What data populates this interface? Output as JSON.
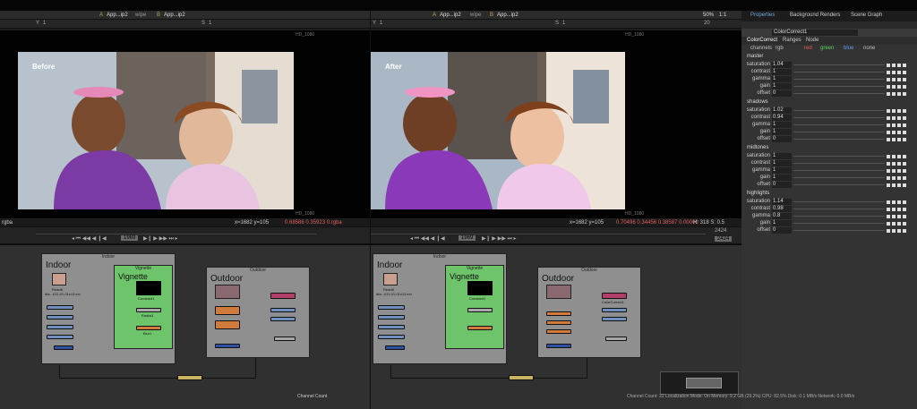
{
  "viewer_left": {
    "tab1": "App...ip2",
    "tab2": "App...ip2",
    "a_label": "A",
    "b_label": "B",
    "wipe": "wipe",
    "ctrl_y": "Y",
    "ctrl_y_val": "1",
    "ctrl_s": "S",
    "ctrl_s_val": "1",
    "before_label": "Before",
    "format_top": "HD_1080",
    "format_bottom": "HD_1080",
    "channel": "rgba",
    "coords": "x=1682 y=105",
    "pixel_vals": "0.68586  0.35923  0.rgba",
    "frame": "1969"
  },
  "viewer_right": {
    "tab1": "App...ip2",
    "tab2": "App...ip2",
    "a_label": "A",
    "b_label": "B",
    "wipe": "wipe",
    "zoom": "50%",
    "ratio": "1:1",
    "ctrl_y": "Y",
    "ctrl_y_val": "1",
    "ctrl_s": "S",
    "ctrl_s_val": "1",
    "ctrl_20": "20",
    "after_label": "After",
    "format_top": "HD_1080",
    "format_bottom": "HD_1080",
    "coords": "x=1682 y=105",
    "pixel_vals": "0.70496  0.34456  0.38587  0.00000",
    "hsv": "H: 318 S: 0.5",
    "frame": "1969",
    "frame_end": "2424",
    "frame_out": "2424"
  },
  "properties": {
    "tabs": [
      "Properties",
      "Background Renders",
      "Scene Graph"
    ],
    "node_name": "ColorCorrect1",
    "subtabs": [
      "ColorCorrect",
      "Ranges",
      "Node"
    ],
    "channels_label": "channels",
    "channels_value": "rgb",
    "chan_red": "red",
    "chan_green": "green",
    "chan_blue": "blue",
    "chan_none": "none",
    "sections": [
      {
        "name": "master",
        "rows": [
          [
            "saturation",
            "1.04"
          ],
          [
            "contrast",
            "1"
          ],
          [
            "gamma",
            "1"
          ],
          [
            "gain",
            "1"
          ],
          [
            "offset",
            "0"
          ]
        ]
      },
      {
        "name": "shadows",
        "rows": [
          [
            "saturation",
            "1.02"
          ],
          [
            "contrast",
            "0.94"
          ],
          [
            "gamma",
            "1"
          ],
          [
            "gain",
            "1"
          ],
          [
            "offset",
            "0"
          ]
        ]
      },
      {
        "name": "midtones",
        "rows": [
          [
            "saturation",
            "1"
          ],
          [
            "contrast",
            "1"
          ],
          [
            "gamma",
            "1"
          ],
          [
            "gain",
            "1"
          ],
          [
            "offset",
            "0"
          ]
        ]
      },
      {
        "name": "highlights",
        "rows": [
          [
            "saturation",
            "1.14"
          ],
          [
            "contrast",
            "0.98"
          ],
          [
            "gamma",
            "0.8"
          ],
          [
            "gain",
            "1"
          ],
          [
            "offset",
            "0"
          ]
        ]
      }
    ]
  },
  "graph_left": {
    "indoor_title": "Indoor",
    "indoor_big": "Indoor",
    "vignette_title": "Vignette",
    "vignette_big": "Vignette",
    "outdoor_title": "Outdoor",
    "outdoor_big": "Outdoor",
    "read_label": "Read8",
    "read_file": "dfa...011-01-01c13.exr",
    "grade": "Grade1",
    "radial": "Radial1",
    "merge": "Blur1",
    "constant": "Constant1"
  },
  "graph_right": {
    "indoor_title": "Indoor",
    "indoor_big": "Indoor",
    "vignette_title": "Vignette",
    "vignette_big": "Vignette",
    "outdoor_title": "Outdoor",
    "outdoor_big": "Outdoor",
    "read_label": "Read8",
    "read_file": "dfa...011-01-01c13.exr",
    "constant": "Constant1",
    "cc": "ColorCorrect1"
  },
  "bottom": {
    "channel_count_left": "Channel Count",
    "status": "Channel Count: 22  Localization Mode: On  Memory: 9.2 GB (29.2%)  CPU: 82.5%  Disk: 0.1 MB/s  Network: 0.0 MB/s"
  },
  "colors": {
    "vignette_backdrop": "#6ec46a",
    "indoor_backdrop": "#8f8f8f",
    "outdoor_backdrop": "#8f8f8f",
    "accent_blue": "#6fa8dc"
  }
}
